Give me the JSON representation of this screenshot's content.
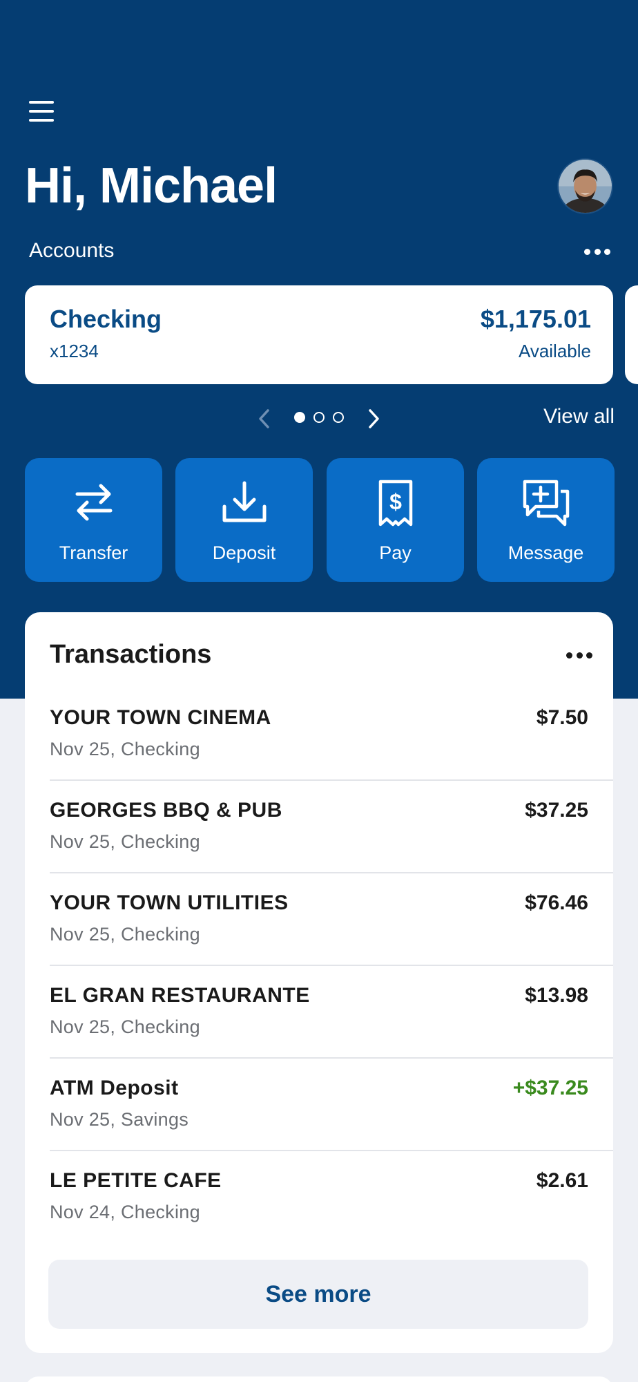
{
  "header": {
    "greeting": "Hi, Michael",
    "accounts_label": "Accounts"
  },
  "account": {
    "name": "Checking",
    "number": "x1234",
    "balance": "$1,175.01",
    "balance_label": "Available"
  },
  "carousel": {
    "active_index": 1,
    "page_count": 3,
    "view_all": "View all"
  },
  "actions": [
    {
      "label": "Transfer",
      "icon": "transfer-icon"
    },
    {
      "label": "Deposit",
      "icon": "deposit-icon"
    },
    {
      "label": "Pay",
      "icon": "pay-bill-icon"
    },
    {
      "label": "Message",
      "icon": "message-icon"
    }
  ],
  "transactions": {
    "title": "Transactions",
    "items": [
      {
        "name": "YOUR TOWN CINEMA",
        "detail": "Nov 25, Checking",
        "amount": "$7.50"
      },
      {
        "name": "GEORGES BBQ & PUB",
        "detail": "Nov 25, Checking",
        "amount": "$37.25"
      },
      {
        "name": "YOUR TOWN UTILITIES",
        "detail": "Nov 25, Checking",
        "amount": "$76.46"
      },
      {
        "name": "EL GRAN RESTAURANTE",
        "detail": "Nov 25, Checking",
        "amount": "$13.98"
      },
      {
        "name": "ATM Deposit",
        "detail": "Nov 25, Savings",
        "amount": "+$37.25"
      },
      {
        "name": "LE PETITE CAFE",
        "detail": "Nov 24, Checking",
        "amount": "$2.61"
      }
    ],
    "see_more": "See more"
  },
  "colors": {
    "header_bg": "#053D72",
    "action_bg": "#0A6CC6",
    "accent_text": "#0A4B85",
    "credit": "#3A8A1E",
    "page_bg": "#EEF0F5"
  }
}
